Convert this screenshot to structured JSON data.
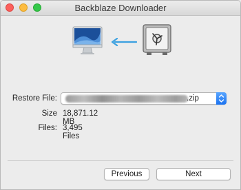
{
  "window": {
    "title": "Backblaze Downloader"
  },
  "illustration": {
    "computer_icon": "imac-icon",
    "arrow_icon": "arrow-left-icon",
    "safe_icon": "safe-icon",
    "arrow_color": "#3aa0e0"
  },
  "form": {
    "restore_file_label": "Restore File:",
    "restore_file_ext": ".zip",
    "size_label": "Size",
    "size_value": "18,871.12 MB",
    "files_label": "Files:",
    "files_value": "3,495 Files"
  },
  "footer": {
    "previous_label": "Previous",
    "next_label": "Next"
  }
}
